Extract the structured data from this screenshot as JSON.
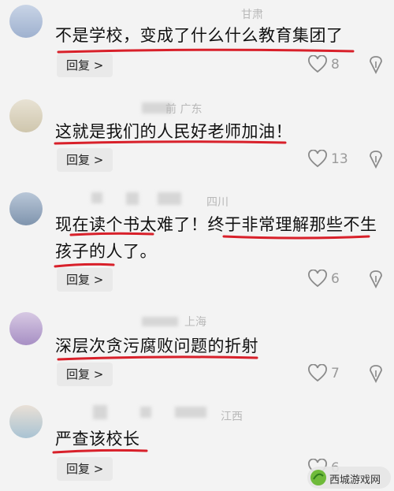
{
  "reply_label": "回复 >",
  "comments": [
    {
      "location": "甘肃",
      "text": "不是学校，变成了什么什么教育集团了",
      "likes": "8"
    },
    {
      "location": "前  广东",
      "text": "这就是我们的人民好老师加油！",
      "likes": "13"
    },
    {
      "location": "四川",
      "text_line1": "现在读个书太难了！终于非常理解那些不生",
      "text_line2": "孩子的人了。",
      "likes": "6"
    },
    {
      "location": "上海",
      "text": "深层次贪污腐败问题的折射",
      "likes": "7"
    },
    {
      "location": "江西",
      "text": "严查该校长",
      "likes": "6"
    }
  ],
  "watermark": "西城游戏网",
  "colors": {
    "underline": "#d8202a",
    "background": "#f3f3f3",
    "text": "#111111"
  }
}
